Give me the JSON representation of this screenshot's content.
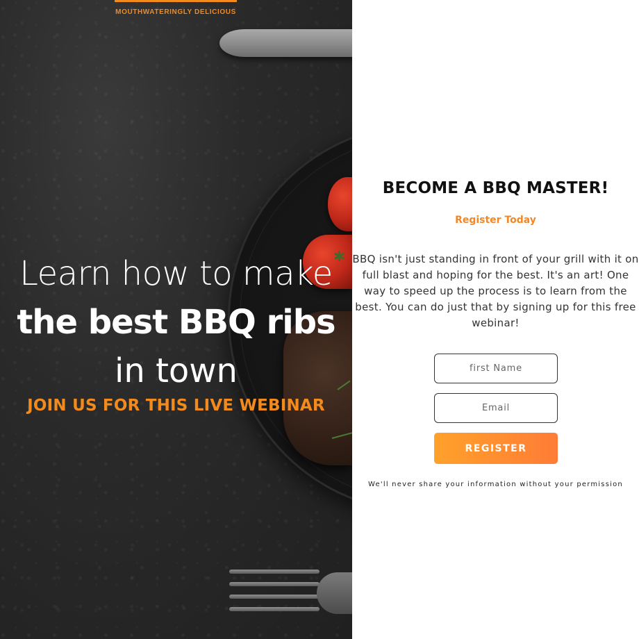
{
  "brand": {
    "tagline": "MOUTHWATERINGLY DELICIOUS",
    "accent_color": "#f28a1e"
  },
  "hero": {
    "line1": "Learn how to make",
    "line2": "the best BBQ ribs",
    "line3": "in town",
    "cta": "JOIN US FOR THIS LIVE WEBINAR"
  },
  "form": {
    "title": "BECOME A BBQ MASTER!",
    "subtitle": "Register Today",
    "body": "BBQ isn't just standing in front of your grill with it on full blast and hoping for the best. It's an art! One way to speed up the process is to learn from the best. You can do just that by signing up for this free webinar!",
    "first_name_placeholder": "first Name",
    "email_placeholder": "Email",
    "register_label": "REGISTER",
    "privacy_note": "We'll never share your information without your permission",
    "button_gradient": [
      "#ffa12b",
      "#ff7c36"
    ]
  }
}
